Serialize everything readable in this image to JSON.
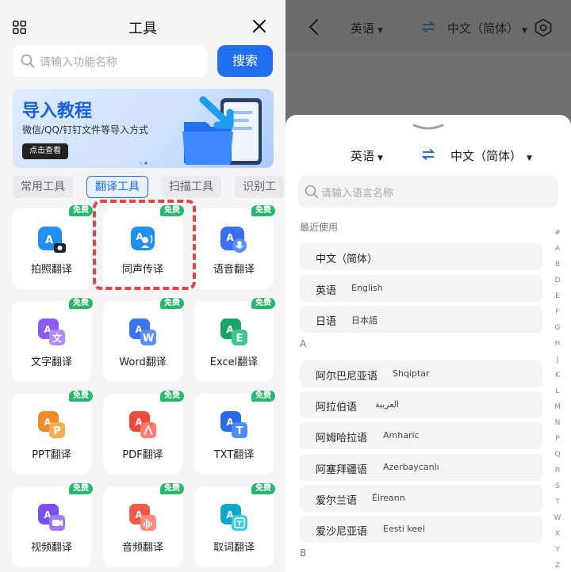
{
  "left": {
    "title": "工具",
    "search_placeholder": "请输入功能名称",
    "search_button": "搜索",
    "banner": {
      "title": "导入教程",
      "subtitle": "微信/QQ/钉钉文件等导入方式",
      "button": "点击查看"
    },
    "tabs": [
      "常用工具",
      "翻译工具",
      "扫描工具",
      "识别工"
    ],
    "active_tab": "翻译工具",
    "badge": "免费",
    "tools": [
      {
        "label": "拍照翻译",
        "icon": "camera-translate-icon"
      },
      {
        "label": "同声传译",
        "icon": "simultaneous-interpret-icon"
      },
      {
        "label": "语音翻译",
        "icon": "voice-translate-icon"
      },
      {
        "label": "文字翻译",
        "icon": "text-translate-icon"
      },
      {
        "label": "Word翻译",
        "icon": "word-translate-icon"
      },
      {
        "label": "Excel翻译",
        "icon": "excel-translate-icon"
      },
      {
        "label": "PPT翻译",
        "icon": "ppt-translate-icon"
      },
      {
        "label": "PDF翻译",
        "icon": "pdf-translate-icon"
      },
      {
        "label": "TXT翻译",
        "icon": "txt-translate-icon"
      },
      {
        "label": "视频翻译",
        "icon": "video-translate-icon"
      },
      {
        "label": "音频翻译",
        "icon": "audio-translate-icon"
      },
      {
        "label": "取词翻译",
        "icon": "word-pick-translate-icon"
      }
    ]
  },
  "right": {
    "top_source": "英语",
    "top_target": "中文（简体）",
    "sheet_source": "英语",
    "sheet_target": "中文（简体）",
    "search_placeholder": "请输入语言名称",
    "recent_label": "最近使用",
    "recent": [
      {
        "zh": "中文（简体）",
        "native": ""
      },
      {
        "zh": "英语",
        "native": "English"
      },
      {
        "zh": "日语",
        "native": "日本語"
      }
    ],
    "section_a": "A",
    "a_list": [
      {
        "zh": "阿尔巴尼亚语",
        "native": "Shqiptar"
      },
      {
        "zh": "阿拉伯语",
        "native": "العربية"
      },
      {
        "zh": "阿姆哈拉语",
        "native": "Amharic"
      },
      {
        "zh": "阿塞拜疆语",
        "native": "Azerbaycanlı"
      },
      {
        "zh": "爱尔兰语",
        "native": "Éireann"
      },
      {
        "zh": "爱沙尼亚语",
        "native": "Eesti keel"
      }
    ],
    "section_b": "B",
    "alphabet": [
      "#",
      "A",
      "B",
      "D",
      "E",
      "F",
      "G",
      "H",
      "J",
      "K",
      "L",
      "M",
      "N",
      "P",
      "Q",
      "R",
      "S",
      "T",
      "W",
      "X",
      "Y",
      "Z"
    ]
  }
}
